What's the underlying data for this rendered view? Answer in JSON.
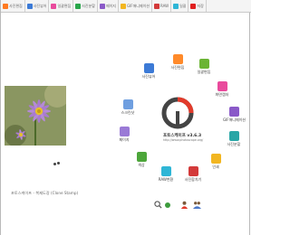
{
  "tabs": [
    {
      "label": "사진편집",
      "color": "#ff7a20"
    },
    {
      "label": "사진뷰어",
      "color": "#3c7ad6"
    },
    {
      "label": "일괄편집",
      "color": "#e94a9c"
    },
    {
      "label": "사진분할",
      "color": "#28a64a"
    },
    {
      "label": "페이지",
      "color": "#8a59c8"
    },
    {
      "label": "GIF애니메이션",
      "color": "#f2b621"
    },
    {
      "label": "RAW",
      "color": "#d33a3a"
    },
    {
      "label": "일괄",
      "color": "#2fb6d6"
    },
    {
      "label": "저장",
      "color": "#e02020"
    }
  ],
  "tools": [
    {
      "label": "사진뷰어",
      "color": "#3c7ad6"
    },
    {
      "label": "사진편집",
      "color": "#ff8a2a"
    },
    {
      "label": "일괄편집",
      "color": "#6bb435"
    },
    {
      "label": "화면캡처",
      "color": "#e94a9c"
    },
    {
      "label": "GIF애니메이션",
      "color": "#8a59c8"
    },
    {
      "label": "사진분할",
      "color": "#28a6a6"
    },
    {
      "label": "인쇄",
      "color": "#f2b621"
    },
    {
      "label": "사진합치기",
      "color": "#d33a3a"
    },
    {
      "label": "RAW변환",
      "color": "#2fb6d6"
    },
    {
      "label": "색상",
      "color": "#4ca63a"
    },
    {
      "label": "페이지",
      "color": "#9a7ad6"
    },
    {
      "label": "스크린샷",
      "color": "#6f9fe0"
    }
  ],
  "logo": {
    "title": "포토스케이프 v3.6.3",
    "url": "http://www.photoscape.org/"
  },
  "footer": {
    "text": "포토스케이프 - 복제도장 (Clone Stamp)"
  }
}
